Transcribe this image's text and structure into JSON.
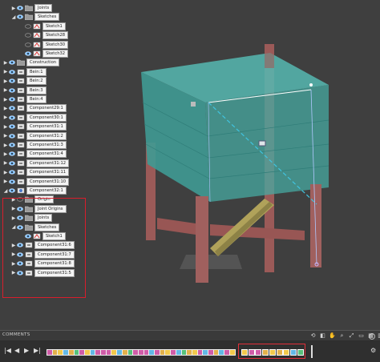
{
  "browser": {
    "nodes": [
      {
        "label": "Joints",
        "icon": "folder",
        "level": 1,
        "arrow": "right"
      },
      {
        "label": "Sketches",
        "icon": "folder",
        "level": 1,
        "arrow": "down"
      },
      {
        "label": "Sketch1",
        "icon": "sketch",
        "level": 2,
        "arrow": "none",
        "hidden": true
      },
      {
        "label": "Sketch28",
        "icon": "sketch",
        "level": 2,
        "arrow": "none",
        "hidden": true
      },
      {
        "label": "Sketch30",
        "icon": "sketch",
        "level": 2,
        "arrow": "none",
        "hidden": true
      },
      {
        "label": "Sketch32",
        "icon": "sketch",
        "level": 2,
        "arrow": "none"
      },
      {
        "label": "Construction",
        "icon": "folder",
        "level": 0,
        "arrow": "right"
      },
      {
        "label": "Bein:1",
        "icon": "component",
        "level": 0,
        "arrow": "right"
      },
      {
        "label": "Bein:2",
        "icon": "component",
        "level": 0,
        "arrow": "right"
      },
      {
        "label": "Bein:3",
        "icon": "component",
        "level": 0,
        "arrow": "right"
      },
      {
        "label": "Bein:4",
        "icon": "component",
        "level": 0,
        "arrow": "right"
      },
      {
        "label": "Component29:1",
        "icon": "component",
        "level": 0,
        "arrow": "right"
      },
      {
        "label": "Component30:1",
        "icon": "component",
        "level": 0,
        "arrow": "right"
      },
      {
        "label": "Component31:1",
        "icon": "component",
        "level": 0,
        "arrow": "right"
      },
      {
        "label": "Component31:2",
        "icon": "component",
        "level": 0,
        "arrow": "right"
      },
      {
        "label": "Component31:3",
        "icon": "component",
        "level": 0,
        "arrow": "right"
      },
      {
        "label": "Component31:4",
        "icon": "component",
        "level": 0,
        "arrow": "right"
      },
      {
        "label": "Component31:12",
        "icon": "component",
        "level": 0,
        "arrow": "right"
      },
      {
        "label": "Component31:11",
        "icon": "component",
        "level": 0,
        "arrow": "right"
      },
      {
        "label": "Component31:10",
        "icon": "component",
        "level": 0,
        "arrow": "right"
      },
      {
        "label": "Component32:1",
        "icon": "component-active",
        "level": 0,
        "arrow": "down"
      },
      {
        "label": "Origin",
        "icon": "folder",
        "level": 1,
        "arrow": "right",
        "hidden": true
      },
      {
        "label": "Joint Origins",
        "icon": "folder",
        "level": 1,
        "arrow": "right"
      },
      {
        "label": "Joints",
        "icon": "folder",
        "level": 1,
        "arrow": "right"
      },
      {
        "label": "Sketches",
        "icon": "folder",
        "level": 1,
        "arrow": "down"
      },
      {
        "label": "Sketch1",
        "icon": "sketch",
        "level": 2,
        "arrow": "none"
      },
      {
        "label": "Component31:6",
        "icon": "component",
        "level": 1,
        "arrow": "right"
      },
      {
        "label": "Component31:7",
        "icon": "component",
        "level": 1,
        "arrow": "right"
      },
      {
        "label": "Component31:8",
        "icon": "component",
        "level": 1,
        "arrow": "right"
      },
      {
        "label": "Component31:5",
        "icon": "component",
        "level": 1,
        "arrow": "right"
      }
    ]
  },
  "comments": {
    "label": "COMMENTS"
  },
  "timeline": {
    "features": [
      "#d05ca8",
      "#e2b04b",
      "#f2c94c",
      "#62b8e6",
      "#e2b04b",
      "#56c17a",
      "#d05ca8",
      "#f2c94c",
      "#62b8e6",
      "#d05ca8",
      "#d05ca8",
      "#d05ca8",
      "#f2c94c",
      "#62b8e6",
      "#e2b04b",
      "#56c17a",
      "#d05ca8",
      "#d05ca8",
      "#d05ca8",
      "#62b8e6",
      "#d05ca8",
      "#e2b04b",
      "#f2c94c",
      "#d05ca8",
      "#62b8e6",
      "#56c17a",
      "#e2b04b",
      "#f2c94c",
      "#d05ca8",
      "#62b8e6",
      "#d05ca8",
      "#e2b04b",
      "#62b8e6",
      "#d05ca8",
      "#f2c94c"
    ],
    "highlighted": [
      "#f2c94c",
      "#d05ca8",
      "#d05ca8",
      "#e2b04b",
      "#f2c94c",
      "#e2b04b",
      "#f2c94c",
      "#62b8e6",
      "#56c17a"
    ]
  },
  "colors": {
    "box": "#3f9a94",
    "box_top": "#56b8b2",
    "wood": "#a0605e",
    "brace": "#b0a25a",
    "selection_red": "#d81e2c",
    "sketch_line": "#40c4e0"
  }
}
